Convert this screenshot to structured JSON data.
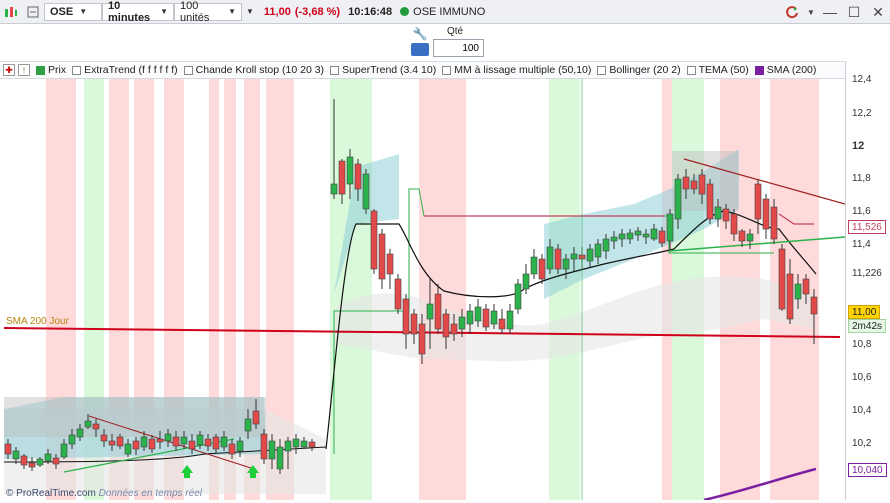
{
  "toolbar": {
    "ticker": "OSE",
    "interval": "10 minutes",
    "units": "100 unités",
    "price": "11,00",
    "change": "(-3,68 %)",
    "time": "10:16:48",
    "name": "OSE IMMUNO"
  },
  "order": {
    "qty_label": "Qté",
    "qty_value": "100"
  },
  "indicators": [
    {
      "label": "Prix",
      "checked": true,
      "color": "#2ea043"
    },
    {
      "label": "ExtraTrend (f f f f f f)",
      "checked": false
    },
    {
      "label": "Chande Kroll stop (10 20 3)",
      "checked": false
    },
    {
      "label": "SuperTrend (3.4 10)",
      "checked": false
    },
    {
      "label": "MM à lissage multiple (50,10)",
      "checked": false
    },
    {
      "label": "Bollinger (20 2)",
      "checked": false
    },
    {
      "label": "TEMA (50)",
      "checked": false
    },
    {
      "label": "SMA (200)",
      "checked": true,
      "color": "#7b1fa2"
    }
  ],
  "axis": {
    "ticks": [
      "12,4",
      "12,2",
      "12",
      "11,8",
      "11,6",
      "11,4",
      "11,226",
      "11,00",
      "10,8",
      "10,6",
      "10,4",
      "10,2",
      "10,040"
    ],
    "tag_price": "11,00",
    "tag_countdown": "2m42s",
    "tag_tema": "11,526",
    "tag_sma": "10,040"
  },
  "chart": {
    "sma_label": "SMA 200 Jour",
    "footer_brand": "© ProRealTime.com",
    "footer_note": "Données en temps réel"
  },
  "colors": {
    "up": "#2bb24c",
    "down": "#e24a4a",
    "accent_red": "#d0021b"
  }
}
